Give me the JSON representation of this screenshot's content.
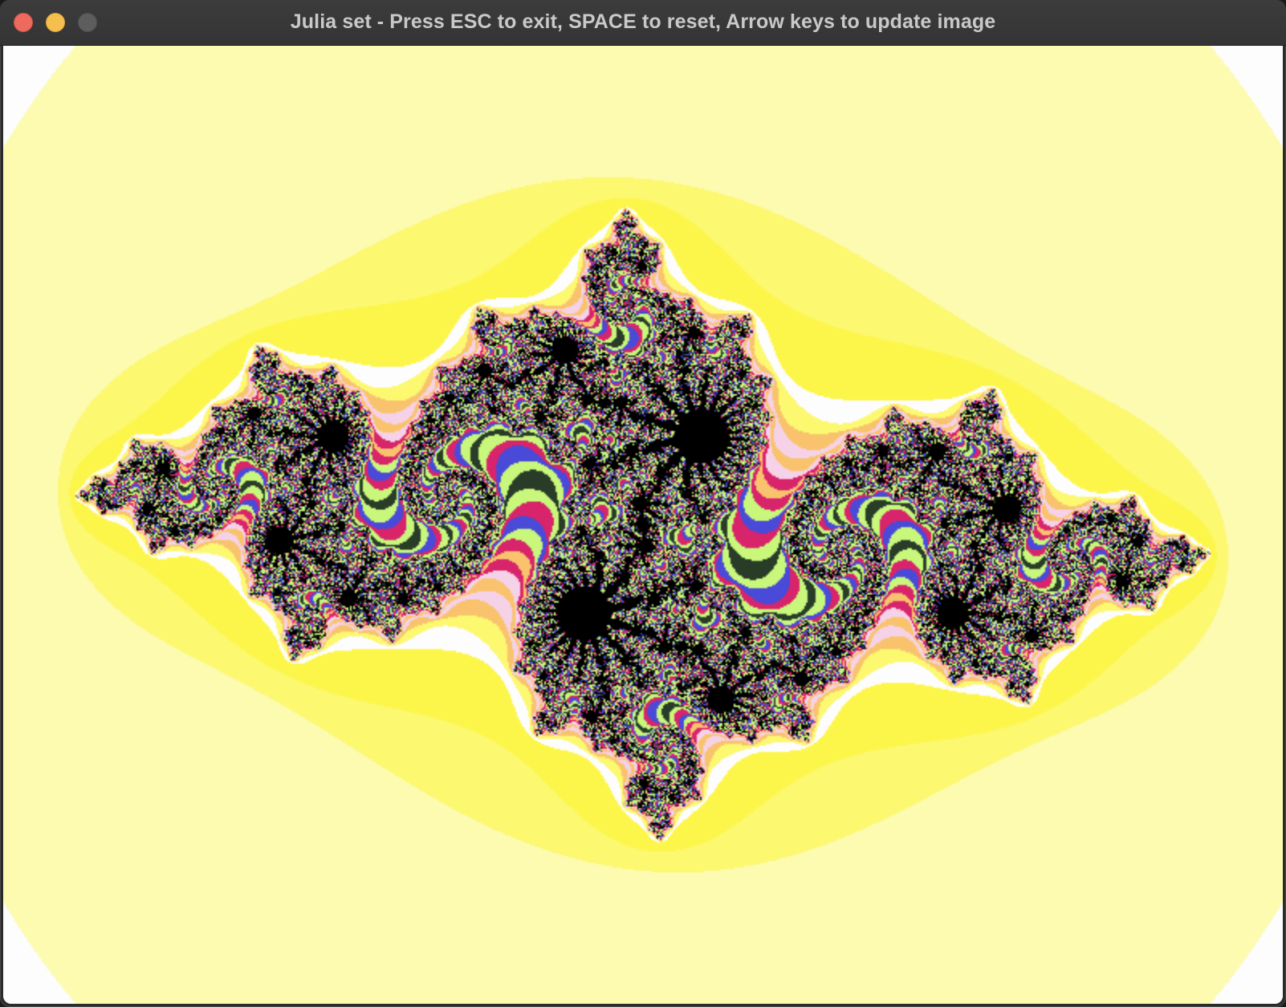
{
  "window": {
    "title": "Julia set - Press ESC to exit, SPACE to reset, Arrow keys to update image",
    "buttons": {
      "close_color": "#ed6a5e",
      "minimize_color": "#f5bf4f",
      "zoom_color": "#5d5d5d"
    }
  },
  "fractal": {
    "type": "julia-set",
    "palette": {
      "background": "#fdfdfd",
      "pale_yellow": "#fcfbb0",
      "yellow": "#fcf870",
      "bright_yellow": "#fdf64a",
      "orange": "#f9c36e",
      "pink": "#f6d2e8",
      "magenta": "#d8246a",
      "lime": "#c8f77c",
      "blue": "#4a4ad8",
      "black": "#000000"
    }
  }
}
